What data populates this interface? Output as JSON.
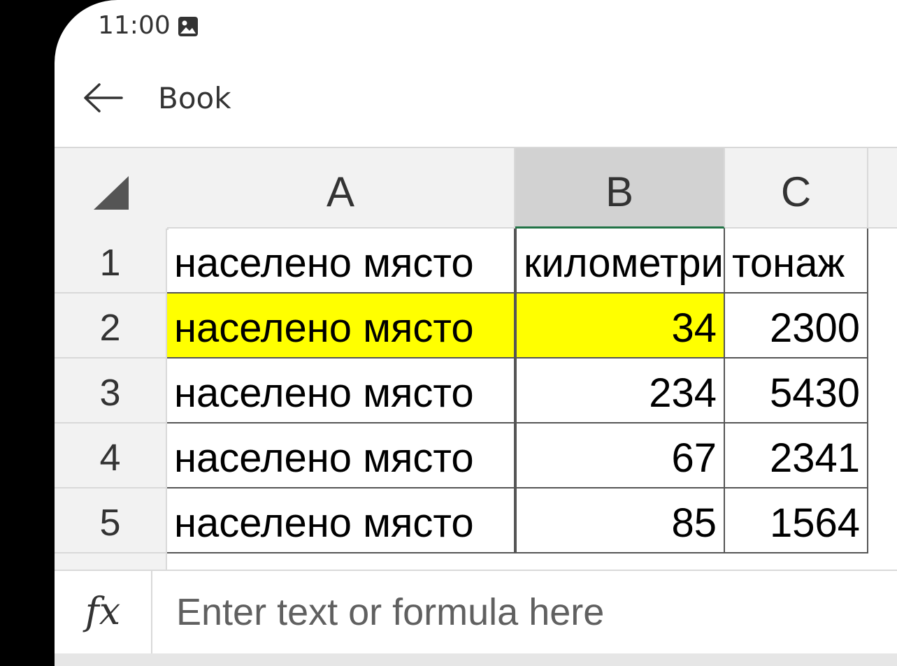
{
  "status_bar": {
    "time": "11:00"
  },
  "app_bar": {
    "title": "Book"
  },
  "sheet": {
    "columns": [
      "A",
      "B",
      "C"
    ],
    "selected_column": "B",
    "rows": [
      {
        "row_label": "1",
        "cells": [
          "населено място",
          "километри",
          "тонаж"
        ]
      },
      {
        "row_label": "2",
        "cells": [
          "населено място",
          "34",
          "2300"
        ]
      },
      {
        "row_label": "3",
        "cells": [
          "населено място",
          "234",
          "5430"
        ]
      },
      {
        "row_label": "4",
        "cells": [
          "населено място",
          "67",
          "2341"
        ]
      },
      {
        "row_label": "5",
        "cells": [
          "населено място",
          "85",
          "1564"
        ]
      }
    ],
    "highlight_color": "#ffff00",
    "accent_color": "#217346"
  },
  "formula_bar": {
    "icon_label": "fx",
    "placeholder": "Enter text or formula here",
    "value": ""
  }
}
